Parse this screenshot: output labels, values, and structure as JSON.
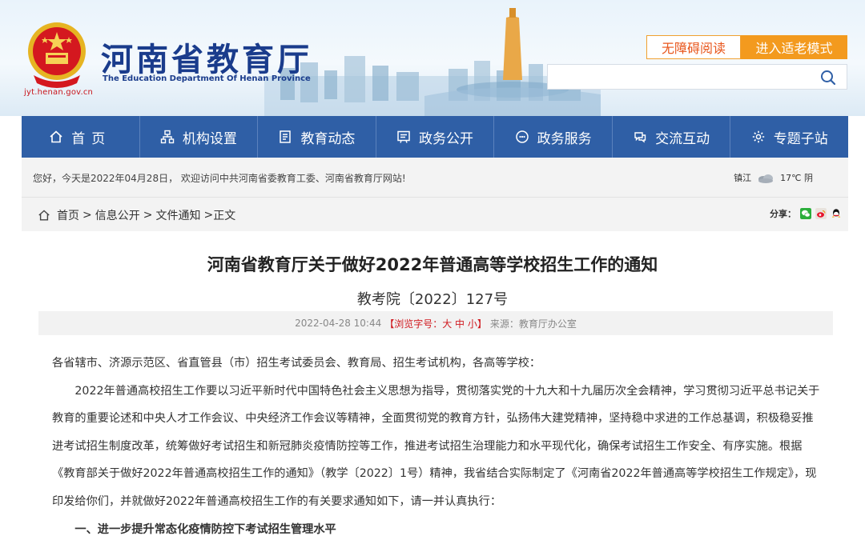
{
  "header": {
    "site_title": "河南省教育厅",
    "site_subtitle": "The Education Department Of Henan Province",
    "domain": "jyt.henan.gov.cn",
    "accessible_label": "无障碍阅读",
    "elder_mode_label": "进入适老模式",
    "search_placeholder": ""
  },
  "nav": {
    "items": [
      {
        "label": "首页",
        "icon": "home-icon"
      },
      {
        "label": "机构设置",
        "icon": "org-chart-icon"
      },
      {
        "label": "教育动态",
        "icon": "document-icon"
      },
      {
        "label": "政务公开",
        "icon": "notice-board-icon"
      },
      {
        "label": "政务服务",
        "icon": "service-icon"
      },
      {
        "label": "交流互动",
        "icon": "chat-icon"
      },
      {
        "label": "专题子站",
        "icon": "gear-icon"
      }
    ]
  },
  "infobar": {
    "welcome": "您好，今天是2022年04月28日， 欢迎访问中共河南省委教育工委、河南省教育厅网站!",
    "city": "镇江",
    "weather": "17℃ 阴"
  },
  "breadcrumb": {
    "items": [
      "首页",
      "信息公开",
      "文件通知"
    ],
    "current": "正文",
    "share_label": "分享："
  },
  "article": {
    "title": "河南省教育厅关于做好2022年普通高等学校招生工作的通知",
    "doc_number": "教考院〔2022〕127号",
    "date": "2022-04-28 10:44",
    "font_size_label": "【浏览字号：大 中 小】",
    "source": "来源：教育厅办公室",
    "paragraphs": [
      "各省辖市、济源示范区、省直管县（市）招生考试委员会、教育局、招生考试机构，各高等学校：",
      "2022年普通高校招生工作要以习近平新时代中国特色社会主义思想为指导，贯彻落实党的十九大和十九届历次全会精神，学习贯彻习近平总书记关于教育的重要论述和中央人才工作会议、中央经济工作会议等精神，全面贯彻党的教育方针，弘扬伟大建党精神，坚持稳中求进的工作总基调，积极稳妥推进考试招生制度改革，统筹做好考试招生和新冠肺炎疫情防控等工作，推进考试招生治理能力和水平现代化，确保考试招生工作安全、有序实施。根据《教育部关于做好2022年普通高校招生工作的通知》（教学〔2022〕1号）精神，我省结合实际制定了《河南省2022年普通高等学校招生工作规定》，现印发给你们，并就做好2022年普通高校招生工作的有关要求通知如下，请一并认真执行：",
      "一、进一步提升常态化疫情防控下考试招生管理水平"
    ]
  },
  "colors": {
    "nav_bg": "#2f5fa6",
    "title_blue": "#1a3c8c",
    "accent_orange": "#f39a1e",
    "accent_red": "#d0191f"
  }
}
